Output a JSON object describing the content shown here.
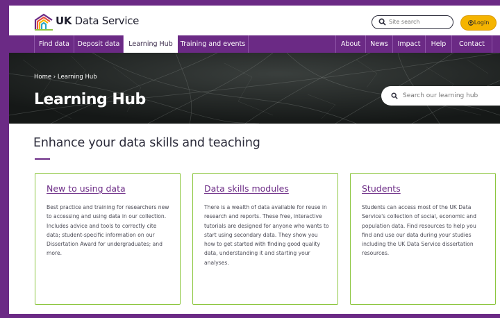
{
  "header": {
    "brand_prefix": "UK",
    "brand_suffix": " Data Service",
    "site_search_placeholder": "Site search",
    "login_label": "Login"
  },
  "nav": {
    "left_items": [
      "Find data",
      "Deposit data",
      "Learning Hub",
      "Training and events"
    ],
    "right_items": [
      "About",
      "News",
      "Impact",
      "Help",
      "Contact"
    ],
    "active": "Learning Hub"
  },
  "hero": {
    "breadcrumb_home": "Home",
    "breadcrumb_sep": " › ",
    "breadcrumb_current": "Learning Hub",
    "title": "Learning Hub",
    "search_placeholder": "Search our learning hub"
  },
  "main": {
    "heading": "Enhance your data skills and teaching",
    "cards": [
      {
        "title": "New to using data",
        "text": "Best practice and training for researchers new to accessing and using data in our collection. Includes advice and tools to correctly cite data; student-specific information on our Dissertation Award for undergraduates; and more."
      },
      {
        "title": "Data skills modules",
        "text": "There is a wealth of data available for reuse in research and reports. These free, interactive tutorials are designed for anyone who wants to start using secondary data. They show you how to get started with finding good quality data, understanding it and starting your analyses."
      },
      {
        "title": "Students",
        "text": "Students can access most of the UK Data Service's collection of social, economic and population data. Find resources to help you find and use our data during your studies including the UK Data Service dissertation resources."
      }
    ]
  },
  "colors": {
    "purple": "#6b2a85",
    "green_border": "#8cc63f",
    "login_yellow": "#f5b400"
  },
  "icons": [
    "service-logo-icon",
    "search-icon",
    "user-icon"
  ]
}
